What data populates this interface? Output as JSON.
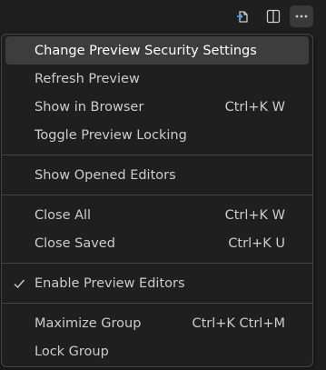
{
  "toolbar": {
    "icons": [
      "open-in-browser-icon",
      "split-editor-icon",
      "more-actions-icon"
    ]
  },
  "menu": {
    "groups": [
      {
        "items": [
          {
            "label": "Change Preview Security Settings",
            "shortcut": ""
          },
          {
            "label": "Refresh Preview",
            "shortcut": ""
          },
          {
            "label": "Show in Browser",
            "shortcut": "Ctrl+K W"
          },
          {
            "label": "Toggle Preview Locking",
            "shortcut": ""
          }
        ]
      },
      {
        "items": [
          {
            "label": "Show Opened Editors",
            "shortcut": ""
          }
        ]
      },
      {
        "items": [
          {
            "label": "Close All",
            "shortcut": "Ctrl+K W"
          },
          {
            "label": "Close Saved",
            "shortcut": "Ctrl+K U"
          }
        ]
      },
      {
        "items": [
          {
            "label": "Enable Preview Editors",
            "shortcut": "",
            "checked": true
          }
        ]
      },
      {
        "items": [
          {
            "label": "Maximize Group",
            "shortcut": "Ctrl+K Ctrl+M"
          },
          {
            "label": "Lock Group",
            "shortcut": ""
          }
        ]
      }
    ]
  },
  "colors": {
    "background": "#1f1f1f",
    "border": "#454545",
    "highlight": "#3d3d3d",
    "text": "#cccccc"
  }
}
